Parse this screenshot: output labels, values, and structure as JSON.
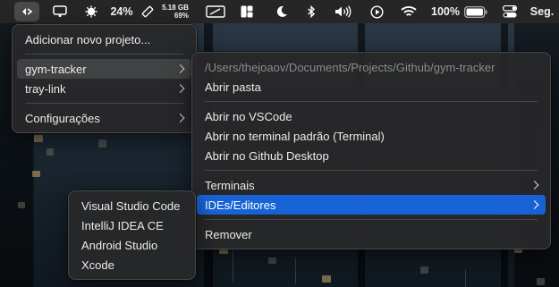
{
  "menubar": {
    "cpu_percent": "24%",
    "memory_used": "5.18 GB",
    "memory_percent": "69%",
    "battery_percent": "100%",
    "clock": "Seg.",
    "icons": [
      "tray-link-icon",
      "display-icon",
      "cpu-icon",
      "ruler-icon",
      "screen-mirror-icon",
      "layout-icon",
      "moon-icon",
      "bluetooth-icon",
      "volume-icon",
      "play-icon",
      "wifi-icon",
      "battery-icon",
      "control-center-icon"
    ]
  },
  "main_menu": {
    "add_project": "Adicionar novo projeto...",
    "projects": [
      "gym-tracker",
      "tray-link"
    ],
    "settings": "Configurações"
  },
  "project_menu": {
    "path": "/Users/thejoaov/Documents/Projects/Github/gym-tracker",
    "open_folder": "Abrir pasta",
    "open_vscode": "Abrir no VSCode",
    "open_terminal": "Abrir no terminal padrão (Terminal)",
    "open_github_desktop": "Abrir no Github Desktop",
    "terminals": "Terminais",
    "ides_editors": "IDEs/Editores",
    "remove": "Remover"
  },
  "ides_menu": {
    "items": [
      "Visual Studio Code",
      "IntelliJ IDEA CE",
      "Android Studio",
      "Xcode"
    ]
  },
  "colors": {
    "selection": "#1763d6",
    "menu_bg": "#28282a",
    "menubar_bg": "#262626"
  }
}
